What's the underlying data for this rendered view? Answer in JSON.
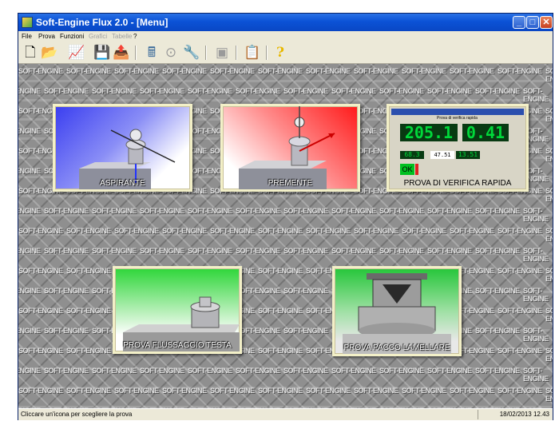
{
  "window": {
    "title": "Soft-Engine Flux 2.0 - [Menu]",
    "controls": {
      "minimize": "_",
      "maximize": "□",
      "close": "✕"
    }
  },
  "menu": [
    {
      "label": "File",
      "enabled": true
    },
    {
      "label": "Prova",
      "enabled": true
    },
    {
      "label": "Funzioni",
      "enabled": true
    },
    {
      "label": "Grafici",
      "enabled": false
    },
    {
      "label": "Tabelle",
      "enabled": false
    },
    {
      "label": "?",
      "enabled": true
    }
  ],
  "toolbar": {
    "new_icon": "🗋",
    "open_icon": "📂",
    "chart_icon": "📈",
    "save_icon": "💾",
    "export_icon": "📤",
    "calc_icon": "🖩",
    "gauge_icon": "⊙",
    "tools_icon": "🔧",
    "grey1_icon": "▣",
    "clipboard_icon": "📋",
    "help_icon": "?"
  },
  "watermark_text": "SOFT-ENGINE",
  "tiles": [
    {
      "id": "aspirante",
      "label": "ASPIRANTE"
    },
    {
      "id": "premente",
      "label": "PREMENTE"
    },
    {
      "id": "verifica",
      "label": "PROVA DI VERIFICA RAPIDA"
    },
    {
      "id": "flussaggio",
      "label": "PROVA FLUSSAGGIO TESTA"
    },
    {
      "id": "pacco",
      "label": "PROVA PACCO LAMELLARE"
    }
  ],
  "verifica_panel": {
    "header": "Prova di verifica rapida",
    "big_value_1": "205.1",
    "big_value_2": "0.41",
    "small_value_1": "68.3",
    "small_value_2": "47.51",
    "small_value_3": "13.51",
    "ok_label": "OK"
  },
  "status": {
    "message": "Cliccare un'icona per scegliere la prova",
    "datetime": "18/02/2013  12.43"
  },
  "colors": {
    "titlebar": "#0b52d6",
    "chrome": "#ece9d8",
    "tile_border": "#f3f0c8",
    "display_green": "#00d93a"
  }
}
